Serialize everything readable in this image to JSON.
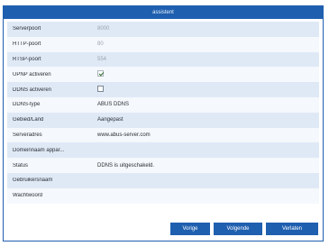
{
  "window": {
    "title": "assistent"
  },
  "fields": [
    {
      "label": "Serverpoort",
      "value": "8000",
      "disabled": true
    },
    {
      "label": "HTTP-poort",
      "value": "80",
      "disabled": true
    },
    {
      "label": "RTSP-poort",
      "value": "554",
      "disabled": true
    },
    {
      "label": "UPNP activeren",
      "checkbox": true,
      "checked": true
    },
    {
      "label": "DDNS activeren",
      "checkbox": true,
      "checked": false
    },
    {
      "label": "DDNS-type",
      "value": "ABUS DDNS"
    },
    {
      "label": "Gebied/Land",
      "value": "Aangepast"
    },
    {
      "label": "Serveradres",
      "value": "www.abus-server.com"
    },
    {
      "label": "Domeinnaam appar...",
      "value": ""
    },
    {
      "label": "Status",
      "value": "DDNS is uitgeschakeld."
    },
    {
      "label": "Gebruikersnaam",
      "value": ""
    },
    {
      "label": "Wachtwoord",
      "value": ""
    }
  ],
  "buttons": {
    "prev": "Vorige",
    "next": "Volgende",
    "cancel": "Verlaten"
  }
}
